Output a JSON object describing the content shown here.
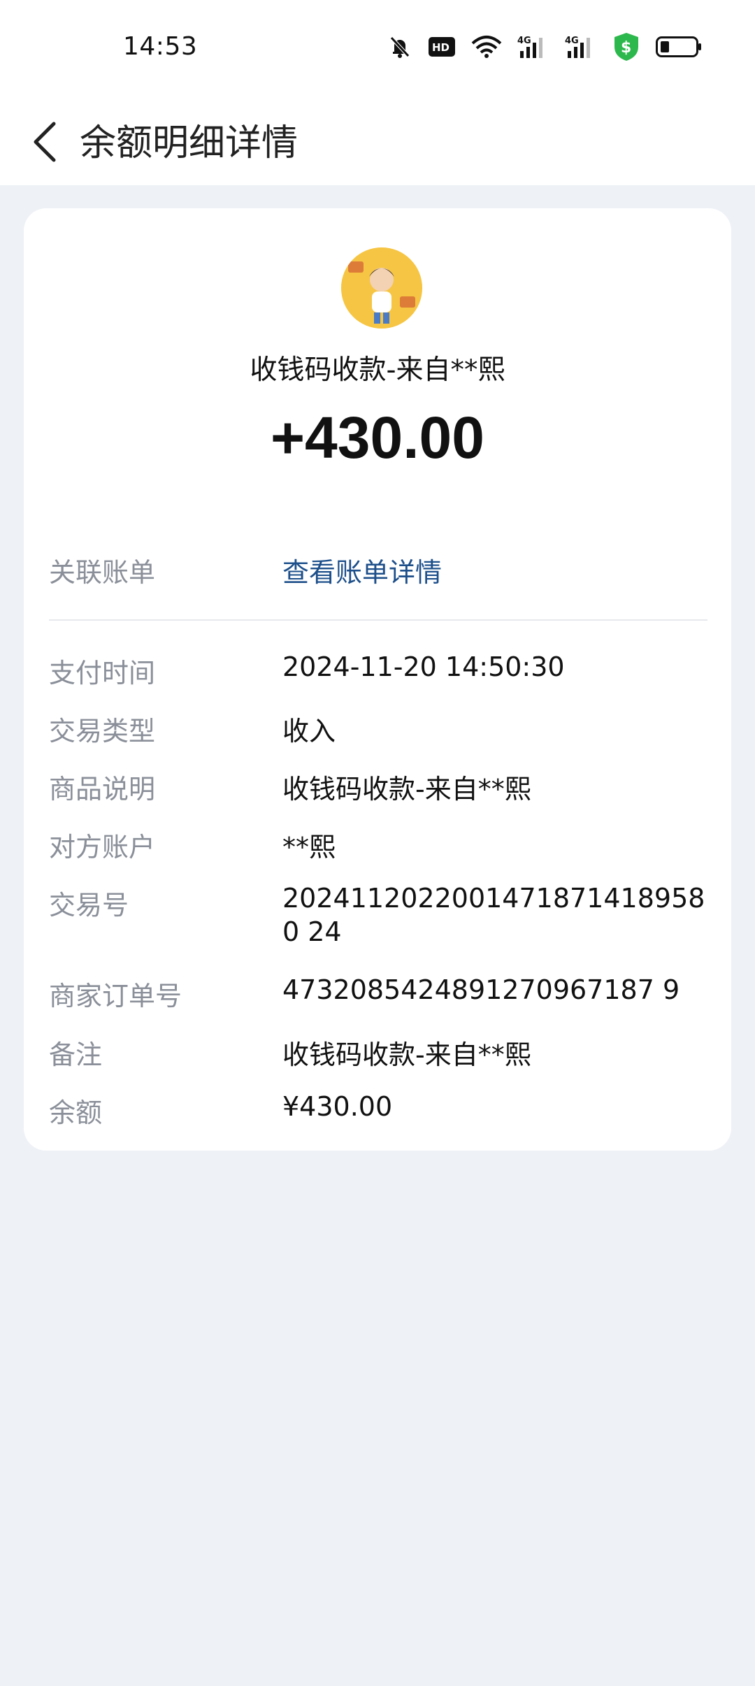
{
  "status_bar": {
    "time": "14:53",
    "icons": [
      "bell-muted-icon",
      "hd-icon",
      "wifi-icon",
      "signal-4g-icon",
      "signal-4g-icon",
      "shield-dollar-icon",
      "battery-icon"
    ]
  },
  "nav": {
    "title": "余额明细详情"
  },
  "card": {
    "payee": "收钱码收款-来自**熙",
    "amount": "+430.00",
    "related_bill_label": "关联账单",
    "related_bill_link": "查看账单详情",
    "rows": [
      {
        "label": "支付时间",
        "value": "2024-11-20 14:50:30"
      },
      {
        "label": "交易类型",
        "value": "收入"
      },
      {
        "label": "商品说明",
        "value": "收钱码收款-来自**熙"
      },
      {
        "label": "对方账户",
        "value": "**熙"
      },
      {
        "label": "交易号",
        "value": "20241120220014718714189580 24"
      },
      {
        "label": "商家订单号",
        "value": "4732085424891270967187 9"
      },
      {
        "label": "备注",
        "value": "收钱码收款-来自**熙"
      },
      {
        "label": "余额",
        "value": "¥430.00"
      }
    ]
  },
  "colors": {
    "page_bg": "#eef1f6",
    "link": "#1d4f8a",
    "label": "#8a8f99",
    "shield": "#2db84d"
  }
}
